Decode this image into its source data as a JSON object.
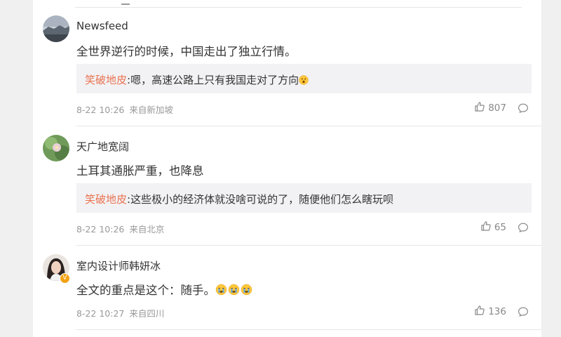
{
  "comments": [
    {
      "username": "Newsfeed",
      "text": "全世界逆行的时候，中国走出了独立行情。",
      "reply": {
        "user": "笑破地皮",
        "text": ":嗯，高速公路上只有我国走对了方向"
      },
      "time": "8-22 10:26",
      "location": "来自新加坡",
      "likes": "807"
    },
    {
      "username": "天广地宽阔",
      "text": "土耳其通胀严重，也降息",
      "reply": {
        "user": "笑破地皮",
        "text": ":这些极小的经济体就没啥可说的了，随便他们怎么瞎玩呗"
      },
      "time": "8-22 10:26",
      "location": "来自北京",
      "likes": "65"
    },
    {
      "username": "室内设计师韩妍冰",
      "text": "全文的重点是这个：随手。",
      "time": "8-22 10:27",
      "location": "来自四川",
      "likes": "136",
      "badge": "V"
    }
  ],
  "icons": {
    "like": "thumbs-up-icon",
    "comment": "comment-bubble-icon"
  },
  "colors": {
    "reply_user": "#eb7350",
    "badge": "#f2a315"
  }
}
